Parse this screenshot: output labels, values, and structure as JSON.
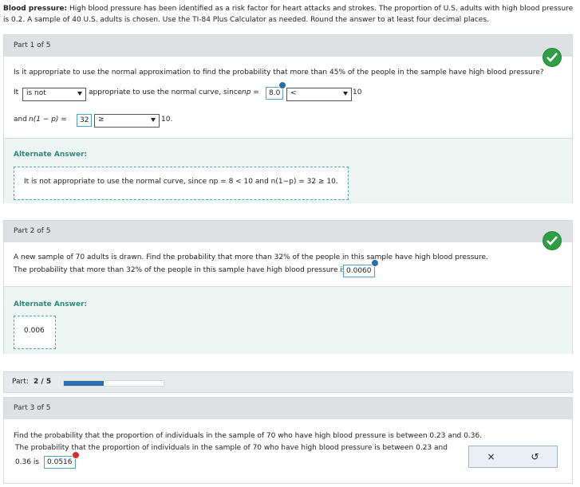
{
  "intro": {
    "bold_label": "Blood pressure:",
    "text": " High blood pressure has been identified as a risk factor for heart attacks and strokes. The proportion of U.S. adults with high blood pressure is 0.2. A sample of 40 U.S. adults is chosen. Use the TI-84 Plus Calculator as needed. Round the answer to at least four decimal places."
  },
  "part1": {
    "header": "Part 1 of 5",
    "question": "Is it appropriate to use the normal approximation to find the probability that more than 45% of the people in the sample have high blood pressure?",
    "it_label": "It",
    "select1": "is not",
    "mid_text": "appropriate to use the normal curve, since",
    "np_label": "np =",
    "np_value": "8.0",
    "select2": "<",
    "ten1": "10",
    "and_label": "and",
    "n1p_label": "n(1 − p) =",
    "n1p_value": "32",
    "select3": "≥",
    "ten2": "10.",
    "alt_label": "Alternate Answer:",
    "alt_text": "It is not appropriate to use the normal curve, since np = 8 < 10 and n(1−p) = 32 ≥ 10."
  },
  "part2": {
    "header": "Part 2 of 5",
    "line1": "A new sample of 70 adults is drawn. Find the probability that more than 32% of the people in this sample have high blood pressure.",
    "line2": "The probability that more than 32% of the people in this sample have high blood pressure is",
    "answer": "0.0060",
    "alt_label": "Alternate Answer:",
    "alt_text": "0.006"
  },
  "progress": {
    "label": "Part:",
    "value": "2 / 5",
    "fraction": 0.4
  },
  "part3": {
    "header": "Part 3 of 5",
    "line1": "Find the probability that the proportion of individuals in the sample of 70 who have high blood pressure is between 0.23 and 0.36.",
    "line2": "The probability that the proportion of individuals in the sample of 70 who have high blood pressure is between 0.23 and",
    "line3_prefix": "0.36 is",
    "answer": "0.0516",
    "clear_symbol": "×",
    "undo_symbol": "↺"
  },
  "colors": {
    "check": "#2f9e44",
    "accent": "#2f6cab",
    "error": "#d93025"
  }
}
